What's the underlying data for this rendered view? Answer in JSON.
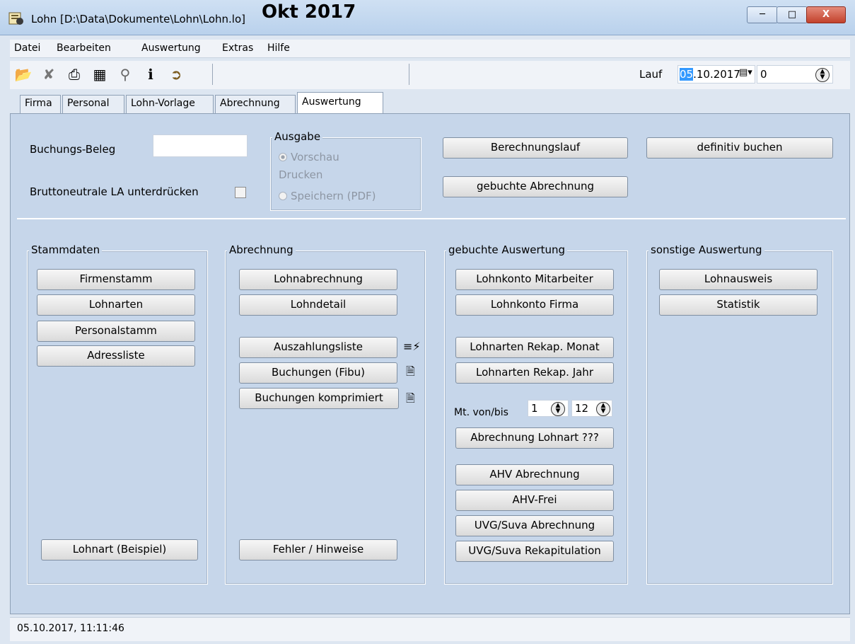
{
  "window": {
    "title": "Lohn [D:\\Data\\Dokumente\\Lohn\\Lohn.lo]"
  },
  "menu": [
    "Datei",
    "Bearbeiten",
    "Auswertung",
    "Extras",
    "Hilfe"
  ],
  "toolbar": {
    "icons": [
      "open-folder-icon",
      "cancel-edit-icon",
      "print-icon",
      "calculator-icon",
      "search-icon",
      "info-icon",
      "exit-icon"
    ],
    "period": "Okt 2017",
    "lauf_label": "Lauf",
    "lauf_date_day": "05",
    "lauf_date_rest": ".10.2017",
    "lauf_number": "0"
  },
  "tabs": [
    "Firma",
    "Personal",
    "Lohn-Vorlage",
    "Abrechnung",
    "Auswertung"
  ],
  "active_tab": "Auswertung",
  "top": {
    "buchungs_beleg_label": "Buchungs-Beleg",
    "buchungs_beleg_value": "",
    "bruttoneutral_label": "Bruttoneutrale LA unterdrücken",
    "ausgabe_label": "Ausgabe",
    "ausgabe_options": [
      "Vorschau",
      "Drucken",
      "Speichern (PDF)"
    ],
    "ausgabe_selected": "Vorschau",
    "berechnungslauf": "Berechnungslauf",
    "definitiv_buchen": "definitiv buchen",
    "gebuchte_abrechnung": "gebuchte Abrechnung"
  },
  "stammdaten": {
    "label": "Stammdaten",
    "buttons": [
      "Firmenstamm",
      "Lohnarten",
      "Personalstamm",
      "Adressliste"
    ],
    "bottom": "Lohnart (Beispiel)"
  },
  "abrechnung": {
    "label": "Abrechnung",
    "buttons": [
      "Lohnabrechnung",
      "Lohndetail"
    ],
    "export_buttons": [
      "Auszahlungsliste",
      "Buchungen (Fibu)",
      "Buchungen komprimiert"
    ],
    "bottom": "Fehler / Hinweise"
  },
  "gebucht": {
    "label": "gebuchte Auswertung",
    "buttons1": [
      "Lohnkonto Mitarbeiter",
      "Lohnkonto Firma"
    ],
    "buttons2": [
      "Lohnarten Rekap. Monat",
      "Lohnarten Rekap. Jahr"
    ],
    "mt_label": "Mt. von/bis",
    "mt_from": "1",
    "mt_to": "12",
    "lohnart_btn": "Abrechnung Lohnart ???",
    "buttons3": [
      "AHV Abrechnung",
      "AHV-Frei",
      "UVG/Suva Abrechnung",
      "UVG/Suva Rekapitulation"
    ]
  },
  "sonstige": {
    "label": "sonstige Auswertung",
    "buttons": [
      "Lohnausweis",
      "Statistik"
    ]
  },
  "status": "05.10.2017, 11:11:46"
}
